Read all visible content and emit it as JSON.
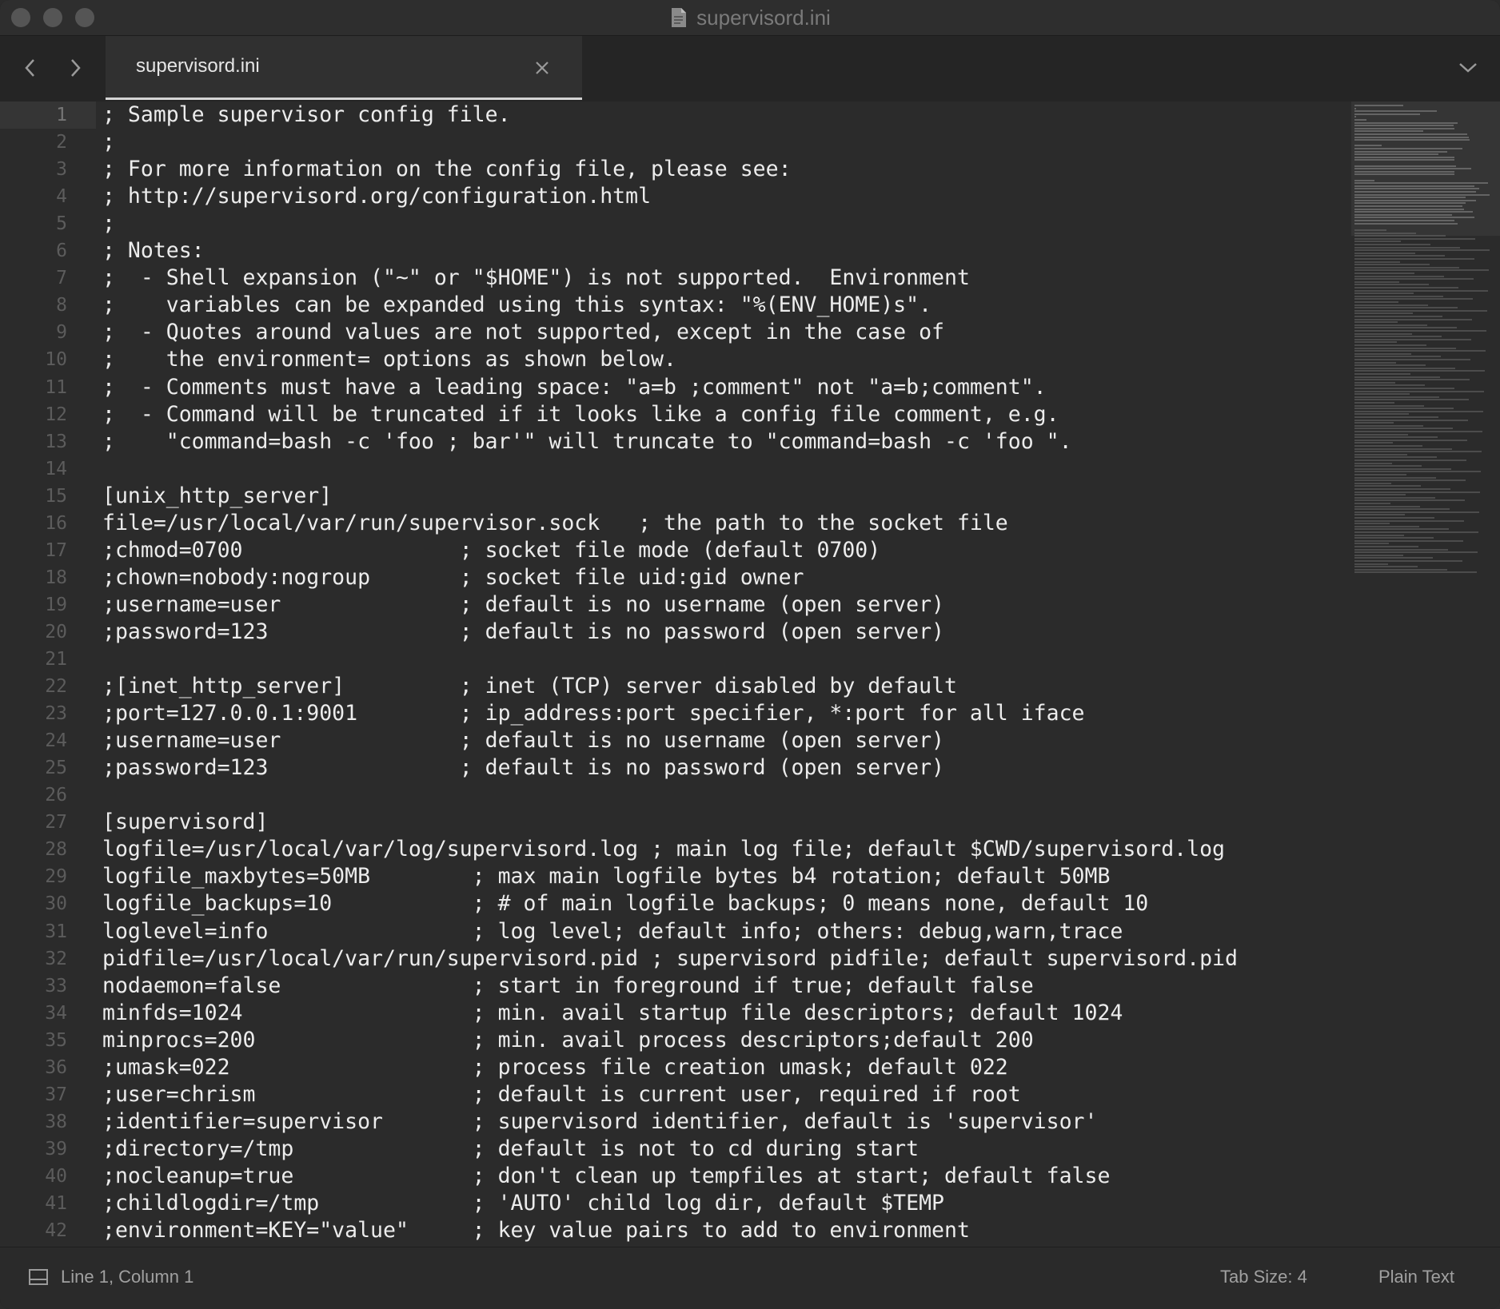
{
  "window": {
    "title": "supervisord.ini"
  },
  "tabs": [
    {
      "label": "supervisord.ini",
      "active": true
    }
  ],
  "editor": {
    "active_line": 1,
    "lines": [
      {
        "n": "1",
        "text": "; Sample supervisor config file."
      },
      {
        "n": "2",
        "text": ";"
      },
      {
        "n": "3",
        "text": "; For more information on the config file, please see:"
      },
      {
        "n": "4",
        "text": "; http://supervisord.org/configuration.html"
      },
      {
        "n": "5",
        "text": ";"
      },
      {
        "n": "6",
        "text": "; Notes:"
      },
      {
        "n": "7",
        "text": ";  - Shell expansion (\"~\" or \"$HOME\") is not supported.  Environment"
      },
      {
        "n": "8",
        "text": ";    variables can be expanded using this syntax: \"%(ENV_HOME)s\"."
      },
      {
        "n": "9",
        "text": ";  - Quotes around values are not supported, except in the case of"
      },
      {
        "n": "10",
        "text": ";    the environment= options as shown below."
      },
      {
        "n": "11",
        "text": ";  - Comments must have a leading space: \"a=b ;comment\" not \"a=b;comment\"."
      },
      {
        "n": "12",
        "text": ";  - Command will be truncated if it looks like a config file comment, e.g."
      },
      {
        "n": "13",
        "text": ";    \"command=bash -c 'foo ; bar'\" will truncate to \"command=bash -c 'foo \"."
      },
      {
        "n": "14",
        "text": ""
      },
      {
        "n": "15",
        "text": "[unix_http_server]"
      },
      {
        "n": "16",
        "text": "file=/usr/local/var/run/supervisor.sock   ; the path to the socket file"
      },
      {
        "n": "17",
        "text": ";chmod=0700                 ; socket file mode (default 0700)"
      },
      {
        "n": "18",
        "text": ";chown=nobody:nogroup       ; socket file uid:gid owner"
      },
      {
        "n": "19",
        "text": ";username=user              ; default is no username (open server)"
      },
      {
        "n": "20",
        "text": ";password=123               ; default is no password (open server)"
      },
      {
        "n": "21",
        "text": ""
      },
      {
        "n": "22",
        "text": ";[inet_http_server]         ; inet (TCP) server disabled by default"
      },
      {
        "n": "23",
        "text": ";port=127.0.0.1:9001        ; ip_address:port specifier, *:port for all iface"
      },
      {
        "n": "24",
        "text": ";username=user              ; default is no username (open server)"
      },
      {
        "n": "25",
        "text": ";password=123               ; default is no password (open server)"
      },
      {
        "n": "26",
        "text": ""
      },
      {
        "n": "27",
        "text": "[supervisord]"
      },
      {
        "n": "28",
        "text": "logfile=/usr/local/var/log/supervisord.log ; main log file; default $CWD/supervisord.log"
      },
      {
        "n": "29",
        "text": "logfile_maxbytes=50MB        ; max main logfile bytes b4 rotation; default 50MB"
      },
      {
        "n": "30",
        "text": "logfile_backups=10           ; # of main logfile backups; 0 means none, default 10"
      },
      {
        "n": "31",
        "text": "loglevel=info                ; log level; default info; others: debug,warn,trace"
      },
      {
        "n": "32",
        "text": "pidfile=/usr/local/var/run/supervisord.pid ; supervisord pidfile; default supervisord.pid"
      },
      {
        "n": "33",
        "text": "nodaemon=false               ; start in foreground if true; default false"
      },
      {
        "n": "34",
        "text": "minfds=1024                  ; min. avail startup file descriptors; default 1024"
      },
      {
        "n": "35",
        "text": "minprocs=200                 ; min. avail process descriptors;default 200"
      },
      {
        "n": "36",
        "text": ";umask=022                   ; process file creation umask; default 022"
      },
      {
        "n": "37",
        "text": ";user=chrism                 ; default is current user, required if root"
      },
      {
        "n": "38",
        "text": ";identifier=supervisor       ; supervisord identifier, default is 'supervisor'"
      },
      {
        "n": "39",
        "text": ";directory=/tmp              ; default is not to cd during start"
      },
      {
        "n": "40",
        "text": ";nocleanup=true              ; don't clean up tempfiles at start; default false"
      },
      {
        "n": "41",
        "text": ";childlogdir=/tmp            ; 'AUTO' child log dir, default $TEMP"
      },
      {
        "n": "42",
        "text": ";environment=KEY=\"value\"     ; key value pairs to add to environment"
      }
    ]
  },
  "statusbar": {
    "position": "Line 1, Column 1",
    "tab_size": "Tab Size: 4",
    "syntax": "Plain Text"
  },
  "icons": {
    "title_doc": "document-icon",
    "nav_back": "chevron-left-icon",
    "nav_forward": "chevron-right-icon",
    "tab_close": "close-icon",
    "tab_menu": "chevron-down-icon",
    "panel": "panel-toggle-icon"
  },
  "colors": {
    "background": "#2b2b2b",
    "text": "#ececec",
    "line_numbers": "#5c5c5c",
    "status_text": "#a0a0a0"
  }
}
